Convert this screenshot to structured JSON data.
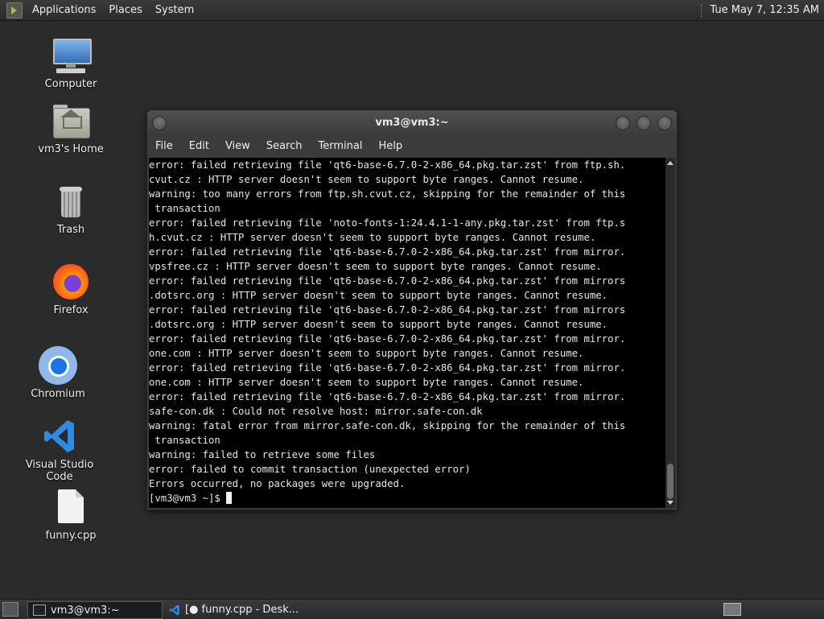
{
  "top_panel": {
    "menus": [
      "Applications",
      "Places",
      "System"
    ],
    "clock": "Tue May  7, 12:35 AM"
  },
  "desktop_icons": [
    {
      "label": "Computer",
      "icon": "computer-icon"
    },
    {
      "label": "vm3's Home",
      "icon": "home-folder-icon"
    },
    {
      "label": "Trash",
      "icon": "trash-icon"
    },
    {
      "label": "Firefox",
      "icon": "firefox-icon"
    },
    {
      "label": "Chromium",
      "icon": "chromium-icon"
    },
    {
      "label": "Visual Studio Code",
      "icon": "vscode-icon"
    },
    {
      "label": "funny.cpp",
      "icon": "file-icon"
    }
  ],
  "terminal": {
    "title": "vm3@vm3:~",
    "menu": [
      "File",
      "Edit",
      "View",
      "Search",
      "Terminal",
      "Help"
    ],
    "lines": [
      "error: failed retrieving file 'qt6-base-6.7.0-2-x86_64.pkg.tar.zst' from ftp.sh.",
      "cvut.cz : HTTP server doesn't seem to support byte ranges. Cannot resume.",
      "warning: too many errors from ftp.sh.cvut.cz, skipping for the remainder of this",
      " transaction",
      "error: failed retrieving file 'noto-fonts-1:24.4.1-1-any.pkg.tar.zst' from ftp.s",
      "h.cvut.cz : HTTP server doesn't seem to support byte ranges. Cannot resume.",
      "error: failed retrieving file 'qt6-base-6.7.0-2-x86_64.pkg.tar.zst' from mirror.",
      "vpsfree.cz : HTTP server doesn't seem to support byte ranges. Cannot resume.",
      "error: failed retrieving file 'qt6-base-6.7.0-2-x86_64.pkg.tar.zst' from mirrors",
      ".dotsrc.org : HTTP server doesn't seem to support byte ranges. Cannot resume.",
      "error: failed retrieving file 'qt6-base-6.7.0-2-x86_64.pkg.tar.zst' from mirrors",
      ".dotsrc.org : HTTP server doesn't seem to support byte ranges. Cannot resume.",
      "error: failed retrieving file 'qt6-base-6.7.0-2-x86_64.pkg.tar.zst' from mirror.",
      "one.com : HTTP server doesn't seem to support byte ranges. Cannot resume.",
      "error: failed retrieving file 'qt6-base-6.7.0-2-x86_64.pkg.tar.zst' from mirror.",
      "one.com : HTTP server doesn't seem to support byte ranges. Cannot resume.",
      "error: failed retrieving file 'qt6-base-6.7.0-2-x86_64.pkg.tar.zst' from mirror.",
      "safe-con.dk : Could not resolve host: mirror.safe-con.dk",
      "warning: fatal error from mirror.safe-con.dk, skipping for the remainder of this",
      " transaction",
      "warning: failed to retrieve some files",
      "error: failed to commit transaction (unexpected error)",
      "Errors occurred, no packages were upgraded."
    ],
    "prompt": "[vm3@vm3 ~]$ "
  },
  "taskbar": {
    "tasks": [
      {
        "label": "vm3@vm3:~",
        "icon": "terminal-icon",
        "active": true
      },
      {
        "label": "[● funny.cpp - Desk...",
        "icon": "vscode-icon",
        "active": false
      }
    ]
  }
}
